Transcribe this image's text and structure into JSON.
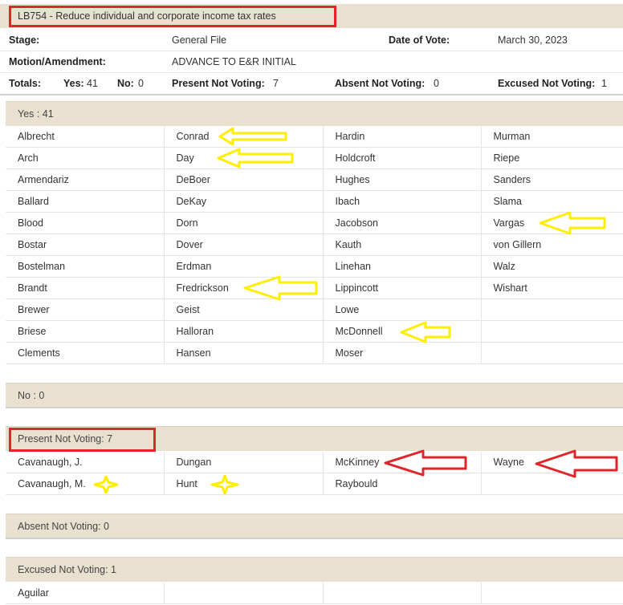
{
  "bill": {
    "title": "LB754 - Reduce individual and corporate income tax rates",
    "stage_label": "Stage:",
    "stage_value": "General File",
    "date_label": "Date of Vote:",
    "date_value": "March 30, 2023",
    "motion_label": "Motion/Amendment:",
    "motion_value": "ADVANCE TO E&R INITIAL"
  },
  "totals": {
    "label": "Totals:",
    "yes_label": "Yes:",
    "yes_value": "41",
    "no_label": "No:",
    "no_value": "0",
    "pnv_label": "Present Not Voting:",
    "pnv_value": "7",
    "anv_label": "Absent Not Voting:",
    "anv_value": "0",
    "env_label": "Excused Not Voting:",
    "env_value": "1"
  },
  "sections": {
    "yes": {
      "header": "Yes : 41",
      "rows": [
        [
          "Albrecht",
          "Conrad",
          "Hardin",
          "Murman"
        ],
        [
          "Arch",
          "Day",
          "Holdcroft",
          "Riepe"
        ],
        [
          "Armendariz",
          "DeBoer",
          "Hughes",
          "Sanders"
        ],
        [
          "Ballard",
          "DeKay",
          "Ibach",
          "Slama"
        ],
        [
          "Blood",
          "Dorn",
          "Jacobson",
          "Vargas"
        ],
        [
          "Bostar",
          "Dover",
          "Kauth",
          "von Gillern"
        ],
        [
          "Bostelman",
          "Erdman",
          "Linehan",
          "Walz"
        ],
        [
          "Brandt",
          "Fredrickson",
          "Lippincott",
          "Wishart"
        ],
        [
          "Brewer",
          "Geist",
          "Lowe",
          ""
        ],
        [
          "Briese",
          "Halloran",
          "McDonnell",
          ""
        ],
        [
          "Clements",
          "Hansen",
          "Moser",
          ""
        ]
      ]
    },
    "no": {
      "header": "No : 0"
    },
    "present_not_voting": {
      "header": "Present Not Voting: 7",
      "rows": [
        [
          "Cavanaugh, J.",
          "Dungan",
          "McKinney",
          "Wayne"
        ],
        [
          "Cavanaugh, M.",
          "Hunt",
          "Raybould",
          ""
        ]
      ]
    },
    "absent_not_voting": {
      "header": "Absent Not Voting: 0"
    },
    "excused_not_voting": {
      "header": "Excused Not Voting: 1",
      "rows": [
        [
          "Aguilar",
          "",
          "",
          ""
        ]
      ]
    }
  },
  "colors": {
    "header_bg": "#e9e1d0",
    "callout_red": "#e0262b",
    "highlight_yellow": "#ffee00"
  }
}
